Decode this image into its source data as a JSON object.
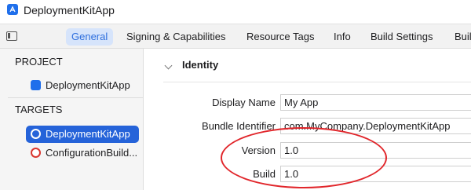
{
  "window": {
    "title": "DeploymentKitApp"
  },
  "icons": {
    "app": "xcode-app-icon",
    "sidebar_toggle": "sidebar-toggle-icon",
    "disclosure": "chevron-down-icon",
    "target": "target-icon",
    "project": "project-file-icon"
  },
  "tabs": [
    {
      "label": "General",
      "active": true
    },
    {
      "label": "Signing & Capabilities"
    },
    {
      "label": "Resource Tags"
    },
    {
      "label": "Info"
    },
    {
      "label": "Build Settings"
    },
    {
      "label": "Buil"
    }
  ],
  "sidebar": {
    "project_heading": "PROJECT",
    "project_items": [
      {
        "label": "DeploymentKitApp"
      }
    ],
    "targets_heading": "TARGETS",
    "target_items": [
      {
        "label": "DeploymentKitApp",
        "selected": true
      },
      {
        "label": "ConfigurationBuild..."
      }
    ]
  },
  "identity": {
    "title": "Identity",
    "fields": [
      {
        "label": "Display Name",
        "value": "My App"
      },
      {
        "label": "Bundle Identifier",
        "value": "com.MyCompany.DeploymentKitApp"
      },
      {
        "label": "Version",
        "value": "1.0"
      },
      {
        "label": "Build",
        "value": "1.0"
      }
    ]
  },
  "colors": {
    "accent": "#2563d9",
    "tab_active_bg": "#d6e4fb",
    "annotation": "#e1262b"
  }
}
